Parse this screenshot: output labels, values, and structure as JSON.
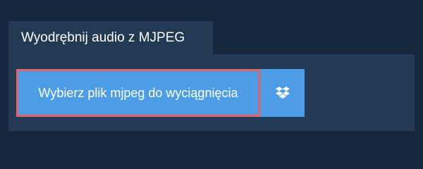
{
  "tab": {
    "title": "Wyodrębnij audio z MJPEG"
  },
  "upload": {
    "choose_file_label": "Wybierz plik mjpeg do wyciągnięcia",
    "dropbox_icon": "dropbox-icon"
  },
  "colors": {
    "page_background": "#15273d",
    "panel_background": "#223a53",
    "button_background": "#4d9de6",
    "focus_outline": "#e16262",
    "text": "#ffffff"
  }
}
